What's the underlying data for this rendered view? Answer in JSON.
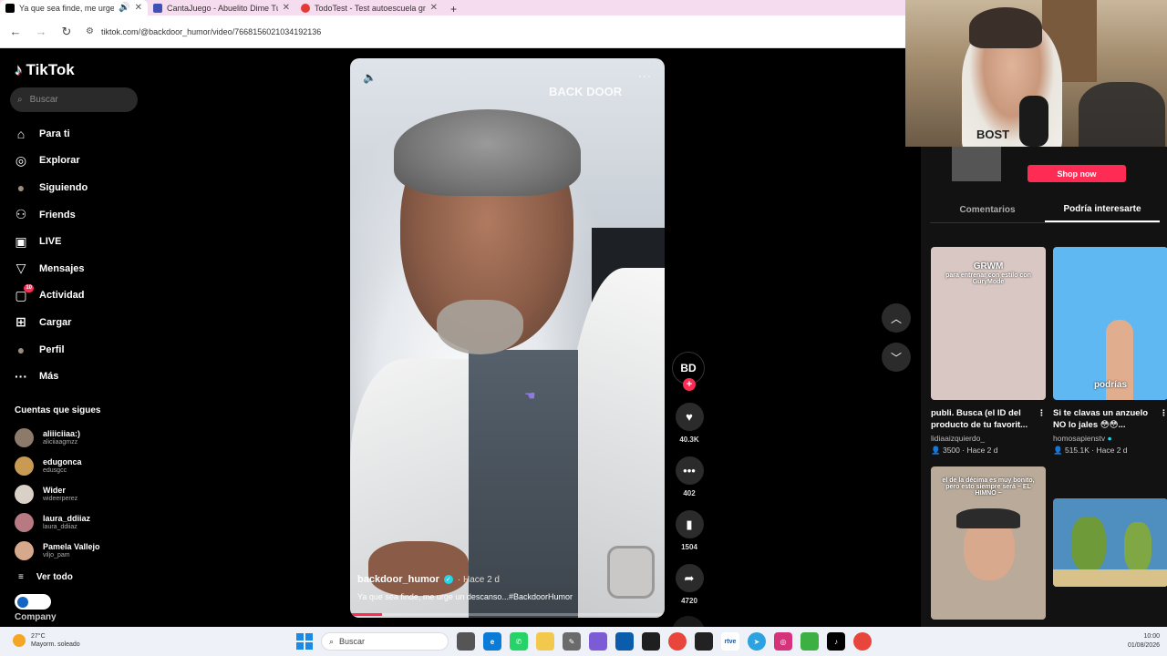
{
  "browser": {
    "tabs": [
      {
        "title": "Ya que sea finde, me urge u",
        "color": "#000000"
      },
      {
        "title": "CantaJuego - Abuelito Dime Tú",
        "color": "#3f51b5"
      },
      {
        "title": "TodoTest - Test autoescuela gra",
        "color": "#e53935"
      }
    ],
    "new_tab": "+",
    "url": "tiktok.com/@backdoor_humor/video/7668156021034192136"
  },
  "sidebar": {
    "logo": "TikTok",
    "search_placeholder": "Buscar",
    "nav": [
      {
        "label": "Para ti",
        "icon": "home-icon",
        "glyph": "⌂"
      },
      {
        "label": "Explorar",
        "icon": "compass-icon",
        "glyph": "◎"
      },
      {
        "label": "Siguiendo",
        "icon": "following-avatar-icon",
        "glyph": "●"
      },
      {
        "label": "Friends",
        "icon": "friends-icon",
        "glyph": "⚇"
      },
      {
        "label": "LIVE",
        "icon": "live-icon",
        "glyph": "▣"
      },
      {
        "label": "Mensajes",
        "icon": "messages-icon",
        "glyph": "▽"
      },
      {
        "label": "Actividad",
        "icon": "activity-icon",
        "glyph": "▢",
        "badge": "10"
      },
      {
        "label": "Cargar",
        "icon": "upload-icon",
        "glyph": "⊞"
      },
      {
        "label": "Perfil",
        "icon": "profile-avatar-icon",
        "glyph": "●"
      },
      {
        "label": "Más",
        "icon": "more-icon",
        "glyph": "···"
      }
    ],
    "following_title": "Cuentas que sigues",
    "following": [
      {
        "name": "aliiiciiaa:)",
        "handle": "aliciiaagmzz",
        "color": "#8c7b6a"
      },
      {
        "name": "edugonca",
        "handle": "edusgcc",
        "color": "#c89a52"
      },
      {
        "name": "Wider",
        "handle": "wideerperez",
        "color": "#d9d0c7"
      },
      {
        "name": "laura_ddiiaz",
        "handle": "laura_ddiiaz",
        "color": "#b77a83"
      },
      {
        "name": "Pamela Vallejo",
        "handle": "viljo_pam",
        "color": "#d7a98c"
      }
    ],
    "see_all": "Ver todo",
    "company": "Company"
  },
  "video": {
    "brand": "BACK DOOR",
    "author": "backdoor_humor",
    "posted": "· Hace 2 d",
    "description": "Ya que sea finde, me urge un descanso...#BackdoorHumor",
    "progress": 0.1
  },
  "actions": {
    "likes": "40.3K",
    "comments": "402",
    "saves": "1504",
    "shares": "4720"
  },
  "right_panel": {
    "shop_now": "Shop now",
    "tabs": [
      "Comentarios",
      "Podría interesarte"
    ],
    "cards": [
      {
        "title": "publi. Busca (el ID del producto de tu favorit...",
        "user": "lidiaaizquierdo_",
        "likes": "3500",
        "age": "Hace 2 d",
        "overlay": "GRWM",
        "overlay2": "para entrenar con estilo con GuryMode",
        "bg": "#d8c7c2"
      },
      {
        "title": "Si te clavas un anzuelo NO lo jales 😳😳...",
        "user": "homosapienstv",
        "likes": "515.1K",
        "age": "Hace 2 d",
        "overlay": "podrías",
        "overlay2": "",
        "bg": "#5fb8f2"
      },
      {
        "title": "",
        "user": "",
        "likes": "",
        "age": "",
        "overlay": "el de la décima es muy bonito, pero esto siempre será ~ EL HIMNO ~",
        "overlay2": "",
        "bg": "#b9aa9a"
      },
      {
        "title": "",
        "user": "",
        "likes": "",
        "age": "",
        "overlay": "",
        "overlay2": "",
        "bg": "#4f8fbf"
      }
    ]
  },
  "taskbar": {
    "temp": "27°C",
    "weather": "Mayorm. soleado",
    "search": "Buscar",
    "time": "10:00",
    "date": "01/08/2026"
  }
}
